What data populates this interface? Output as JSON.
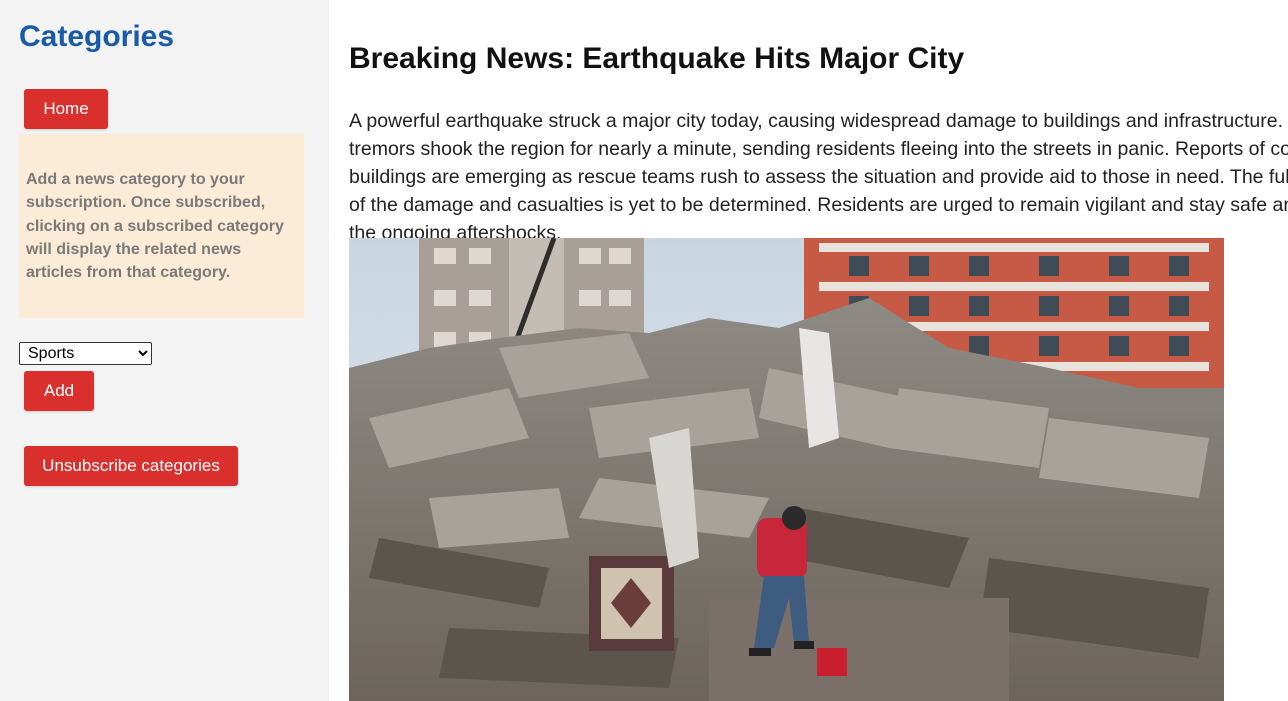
{
  "sidebar": {
    "title": "Categories",
    "home_label": "Home",
    "info_text": "Add a news category to your subscription. Once subscribed, clicking on a subscribed category will display the related news articles from that category.",
    "category_select": {
      "selected": "Sports",
      "options": [
        "Sports"
      ]
    },
    "add_label": "Add",
    "unsubscribe_label": "Unsubscribe categories"
  },
  "article": {
    "headline": "Breaking News: Earthquake Hits Major City",
    "body": "A powerful earthquake struck a major city today, causing widespread damage to buildings and infrastructure. The tremors shook the region for nearly a minute, sending residents fleeing into the streets in panic. Reports of collapsed buildings are emerging as rescue teams rush to assess the situation and provide aid to those in need. The full extent of the damage and casualties is yet to be determined. Residents are urged to remain vigilant and stay safe amidst the ongoing aftershocks."
  },
  "colors": {
    "accent": "#d9302e",
    "title": "#1a5ba8",
    "sidebar_bg": "#f3f3f3",
    "info_bg": "#fcebd6"
  }
}
